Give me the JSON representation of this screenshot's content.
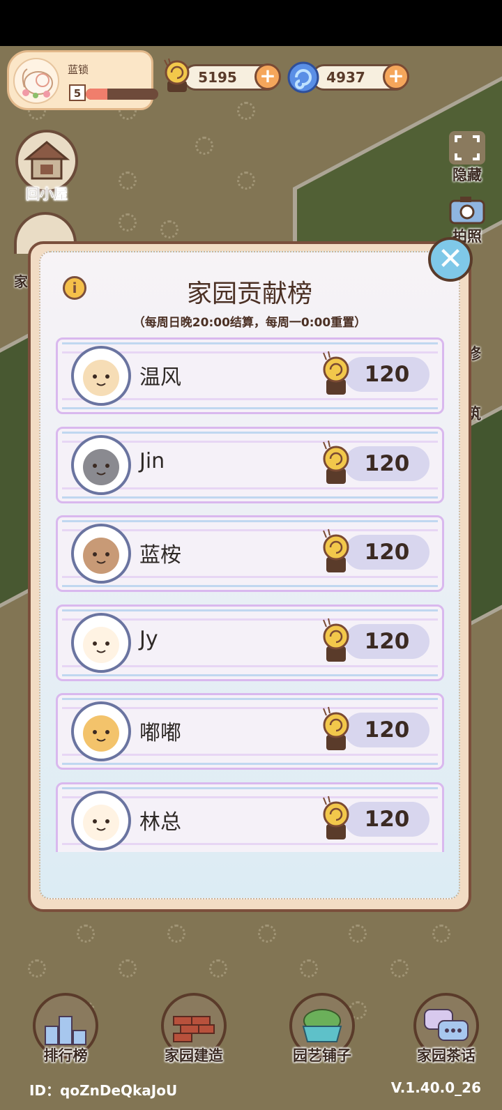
{
  "player": {
    "name": "蓝锁",
    "level": "5",
    "level_progress": 0.3
  },
  "currencies": [
    {
      "name": "snail-coin",
      "value": "5195"
    },
    {
      "name": "blue-swirl",
      "value": "4937"
    }
  ],
  "side_buttons": {
    "home": "回小屋",
    "partial_left": "家"
  },
  "right_tools": {
    "hide": "隐藏",
    "photo": "拍照",
    "repair_partial": "修",
    "build_partial": "筑"
  },
  "modal": {
    "title": "家园贡献榜",
    "subtitle": "（每周日晚20:00结算，每周一0:00重置）",
    "info_icon": "i",
    "close_icon": "✕"
  },
  "ranking": [
    {
      "name": "温风",
      "score": "120",
      "avatar": "koi-fish-avatar"
    },
    {
      "name": "Jin",
      "score": "120",
      "avatar": "gray-cat-avatar"
    },
    {
      "name": "蓝桉",
      "score": "120",
      "avatar": "bear-avatar"
    },
    {
      "name": "Jy",
      "score": "120",
      "avatar": "burger-avatar"
    },
    {
      "name": "嘟嘟",
      "score": "120",
      "avatar": "cat-chef-avatar"
    },
    {
      "name": "林总",
      "score": "120",
      "avatar": "burger-avatar"
    }
  ],
  "bottom_nav": [
    {
      "label": "排行榜"
    },
    {
      "label": "家园建造"
    },
    {
      "label": "园艺铺子"
    },
    {
      "label": "家园茶话"
    }
  ],
  "footer": {
    "id": "ID：qoZnDeQkaJoU",
    "version": "V.1.40.0_26"
  }
}
